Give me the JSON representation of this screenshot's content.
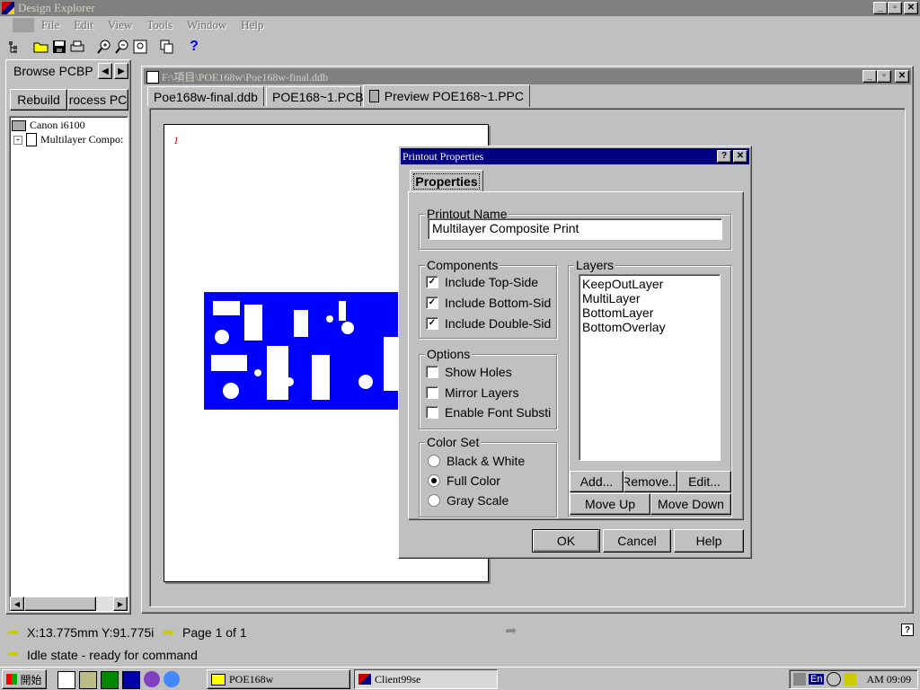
{
  "app": {
    "title": "Design Explorer",
    "menu": [
      "File",
      "Edit",
      "View",
      "Tools",
      "Window",
      "Help"
    ]
  },
  "left_panel": {
    "title": "Browse PCBP",
    "rebuild": "Rebuild",
    "process": "rocess PC",
    "tree": [
      "Canon i6100",
      "Multilayer Compo:"
    ]
  },
  "doc": {
    "path": "F:\\項目\\POE168w\\Poe168w-final.ddb",
    "tabs": [
      "Poe168w-final.ddb",
      "POE168~1.PCB",
      "Preview POE168~1.PPC"
    ],
    "page_number": "1"
  },
  "dialog": {
    "title": "Printout Properties",
    "tab": "Properties",
    "printout_name_label": "Printout Name",
    "printout_name_value": "Multilayer Composite Print",
    "components_label": "Components",
    "components": [
      {
        "label": "Include Top-Side",
        "checked": true
      },
      {
        "label": "Include Bottom-Sid",
        "checked": true
      },
      {
        "label": "Include Double-Sid",
        "checked": true
      }
    ],
    "options_label": "Options",
    "options": [
      {
        "label": "Show Holes",
        "checked": false
      },
      {
        "label": "Mirror Layers",
        "checked": false
      },
      {
        "label": "Enable Font Substi",
        "checked": false
      }
    ],
    "colorset_label": "Color Set",
    "colorset": [
      {
        "label": "Black & White",
        "selected": false
      },
      {
        "label": "Full Color",
        "selected": true
      },
      {
        "label": "Gray Scale",
        "selected": false
      }
    ],
    "layers_label": "Layers",
    "layers": [
      "KeepOutLayer",
      "MultiLayer",
      "BottomLayer",
      "BottomOverlay"
    ],
    "buttons": {
      "add": "Add...",
      "remove": "Remove...",
      "edit": "Edit...",
      "move_up": "Move Up",
      "move_down": "Move Down",
      "ok": "OK",
      "cancel": "Cancel",
      "help": "Help"
    }
  },
  "status": {
    "coords": "X:13.775mm Y:91.775i",
    "page": "Page 1 of 1",
    "state": "Idle state - ready for command"
  },
  "taskbar": {
    "start": "開始",
    "tasks": [
      "POE168w",
      "Client99se"
    ],
    "ime": "En",
    "clock": "AM 09:09"
  },
  "colors": {
    "titlebar_dialog": "#000080",
    "titlebar_inactive": "#808080",
    "pcb_blue": "#0000ff"
  }
}
